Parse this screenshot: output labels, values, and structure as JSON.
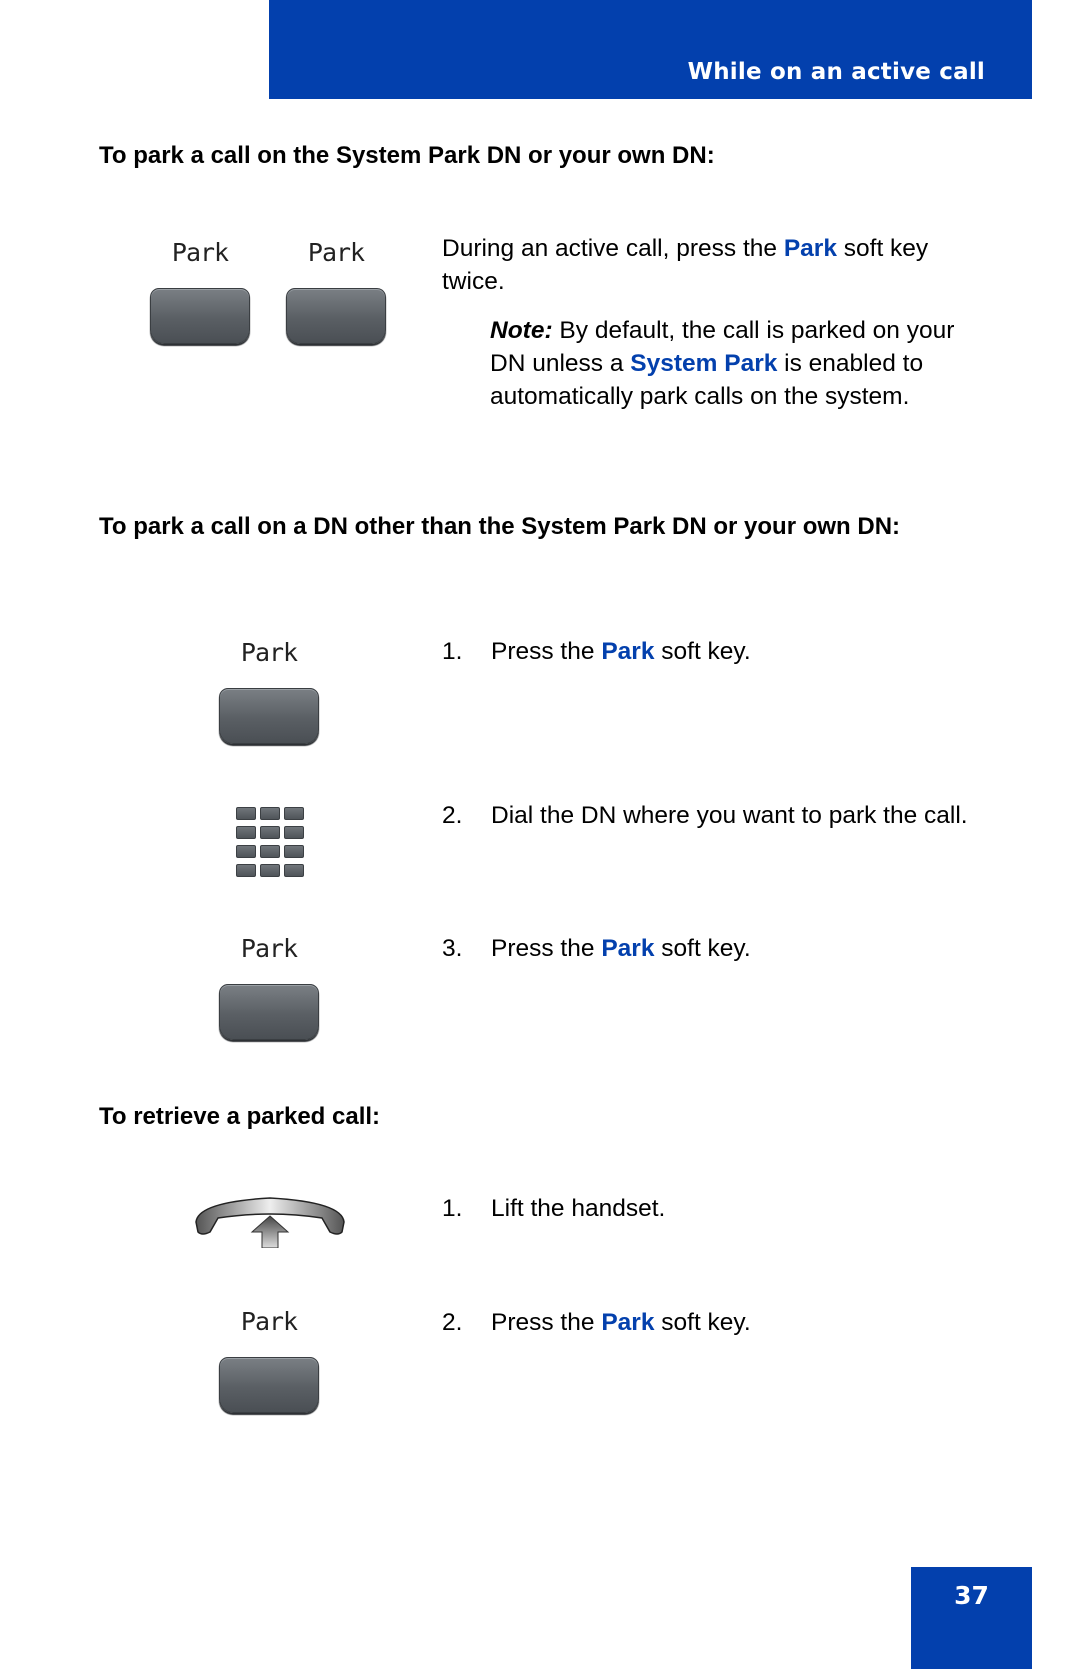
{
  "header": {
    "title": "While on an active call",
    "color": "#0340ad"
  },
  "sections": [
    {
      "title": "To park a call on the System Park DN or your own DN:",
      "softkeys": [
        "Park",
        "Park"
      ],
      "instruction": {
        "pre": "During an active call, press the ",
        "kw": "Park",
        "post": " soft key twice."
      },
      "note": {
        "label": "Note:",
        "pre": " By default, the call is parked on your DN unless a ",
        "kw": "System Park",
        "post": " is enabled to automatically park calls on the system."
      }
    },
    {
      "title": "To park a call on a DN other than the System Park DN or your own DN:",
      "steps": [
        {
          "num": "1.",
          "pre": "Press the ",
          "kw": "Park",
          "post": " soft key.",
          "softkey": "Park"
        },
        {
          "num": "2.",
          "pre": "Dial the DN where you want to park the call.",
          "kw": "",
          "post": ""
        },
        {
          "num": "3.",
          "pre": "Press the ",
          "kw": "Park",
          "post": " soft key.",
          "softkey": "Park"
        }
      ]
    },
    {
      "title": "To retrieve a parked call:",
      "steps": [
        {
          "num": "1.",
          "pre": "Lift the handset.",
          "kw": "",
          "post": ""
        },
        {
          "num": "2.",
          "pre": "Press the ",
          "kw": "Park",
          "post": " soft key.",
          "softkey": "Park"
        }
      ]
    }
  ],
  "icons": {
    "keypad": "dialpad-icon",
    "handset": "lift-handset-icon"
  },
  "page_number": "37"
}
